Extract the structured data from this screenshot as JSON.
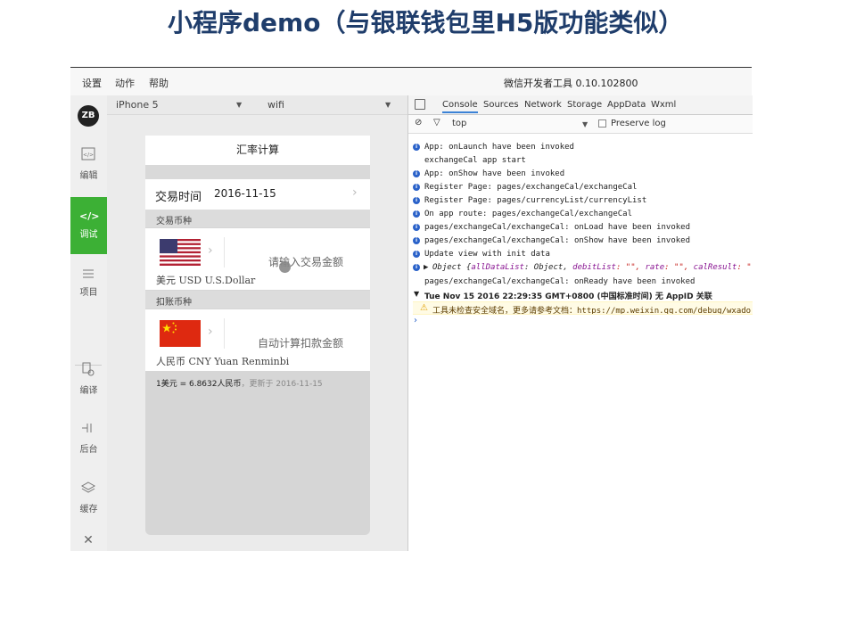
{
  "slide_title": "小程序demo（与银联钱包里H5版功能类似）",
  "window": {
    "menu": [
      "设置",
      "动作",
      "帮助"
    ],
    "title": "微信开发者工具 0.10.102800"
  },
  "sidebar": {
    "avatar_text": "ZB",
    "items": [
      {
        "label": "编辑",
        "icon": "code-file-icon"
      },
      {
        "label": "调试",
        "icon": "code-icon",
        "active": true
      },
      {
        "label": "项目",
        "icon": "menu-icon"
      },
      {
        "label": "编译",
        "icon": "compile-icon"
      },
      {
        "label": "后台",
        "icon": "background-icon"
      },
      {
        "label": "缓存",
        "icon": "layers-icon"
      }
    ]
  },
  "simulator": {
    "device": "iPhone 5",
    "network": "wifi",
    "nav_title": "汇率计算",
    "trade_time_label": "交易时间",
    "trade_time_value": "2016-11-15",
    "trade_currency_header": "交易币种",
    "trade_currency_name": "美元 USD U.S.Dollar",
    "trade_amount_placeholder": "请输入交易金额",
    "debit_currency_header": "扣账币种",
    "debit_currency_name": "人民币 CNY Yuan Renminbi",
    "debit_amount_placeholder": "自动计算扣款金额",
    "rate_text": "1美元 = 6.8632人民币",
    "updated_text": "，更新于 2016-11-15"
  },
  "devtools": {
    "tabs": [
      "Console",
      "Sources",
      "Network",
      "Storage",
      "AppData",
      "Wxml"
    ],
    "active_tab": "Console",
    "context": "top",
    "preserve_log_label": "Preserve log",
    "logs": [
      {
        "type": "info",
        "text": "App: onLaunch have been invoked"
      },
      {
        "type": "plain",
        "text": "exchangeCal app start"
      },
      {
        "type": "info",
        "text": "App: onShow have been invoked"
      },
      {
        "type": "info",
        "text": "Register Page: pages/exchangeCal/exchangeCal"
      },
      {
        "type": "info",
        "text": "Register Page: pages/currencyList/currencyList"
      },
      {
        "type": "info",
        "text": "On app route: pages/exchangeCal/exchangeCal"
      },
      {
        "type": "info",
        "text": "pages/exchangeCal/exchangeCal: onLoad have been invoked"
      },
      {
        "type": "info",
        "text": "pages/exchangeCal/exchangeCal: onShow have been invoked"
      },
      {
        "type": "info",
        "text": "Update view with init data"
      }
    ],
    "object_line": {
      "prefix": "Object {",
      "k1": "allDataList",
      "v1": ": Object, ",
      "k2": "debitList",
      "v2": ": \"\", ",
      "k3": "rate",
      "v3": ": \"\", ",
      "k4": "calResult",
      "v4": ": \"\", ("
    },
    "ready_line": "pages/exchangeCal/exchangeCal: onReady have been invoked",
    "group_line": "Tue Nov 15 2016 22:29:35 GMT+0800 (中国标准时间) 无 AppID 关联",
    "warning_text": "工具未检查安全域名，更多请参考文档：",
    "warning_url": "https://mp.weixin.qq.com/debug/wxado",
    "colors": {
      "accent_green": "#3cb035",
      "info_blue": "#2a62c9",
      "warning_bg": "#fffbe5"
    }
  }
}
